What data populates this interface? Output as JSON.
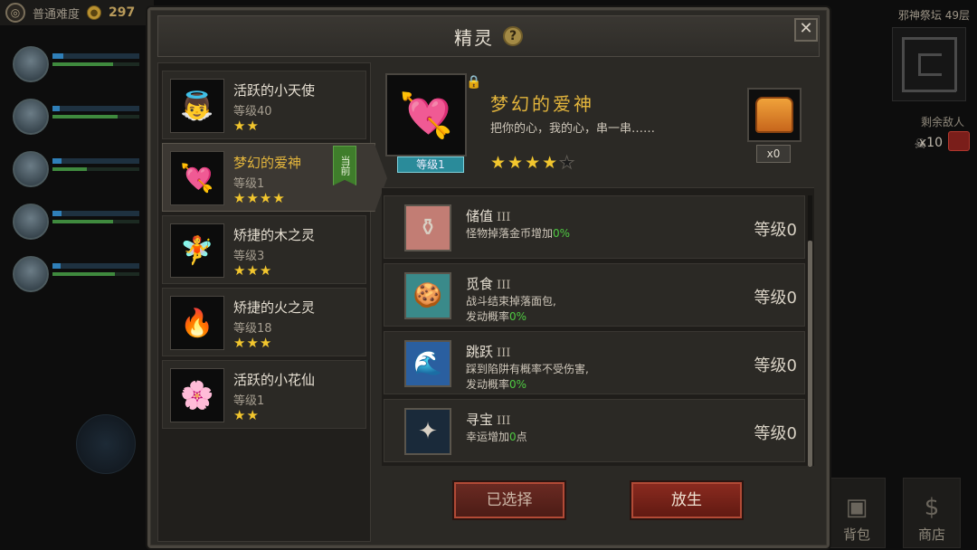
{
  "background": {
    "difficulty_label": "普通难度",
    "coin_value": "297",
    "altar_name": "邪神祭坛 49层",
    "remaining_label": "剩余敌人",
    "enemy_count": "x10",
    "bag_label": "背包",
    "shop_label": "商店",
    "party": [
      {
        "hp": 0.12,
        "mp": 0.7
      },
      {
        "hp": 0.08,
        "mp": 0.75
      },
      {
        "hp": 0.1,
        "mp": 0.4
      },
      {
        "hp": 0.1,
        "mp": 0.7
      },
      {
        "hp": 0.09,
        "mp": 0.72
      }
    ]
  },
  "modal": {
    "title": "精灵",
    "help": "?",
    "close": "✕"
  },
  "spirits": [
    {
      "name": "活跃的小天使",
      "level": "等级40",
      "stars": "★★",
      "icon": "angel",
      "selected": false
    },
    {
      "name": "梦幻的爱神",
      "level": "等级1",
      "stars": "★★★★",
      "icon": "cupid",
      "selected": true,
      "current_tag": "当前"
    },
    {
      "name": "矫捷的木之灵",
      "level": "等级3",
      "stars": "★★★",
      "icon": "wood-spirit",
      "selected": false
    },
    {
      "name": "矫捷的火之灵",
      "level": "等级18",
      "stars": "★★★",
      "icon": "fire-spirit",
      "selected": false
    },
    {
      "name": "活跃的小花仙",
      "level": "等级1",
      "stars": "★★",
      "icon": "flower-fairy",
      "selected": false
    }
  ],
  "detail": {
    "name": "梦幻的爱神",
    "description": "把你的心，我的心，串一串……",
    "level_badge": "等级1",
    "stars_on": "★★★★",
    "stars_off": "★",
    "item_count": "x0"
  },
  "skills": [
    {
      "name": "储值",
      "tier": "III",
      "desc_pre": "怪物掉落金币增加",
      "pct": "0%",
      "desc_post": "",
      "desc_line2_pre": "",
      "desc_line2_pct": "",
      "level": "等级0",
      "icon": "vase-icon",
      "bg": "#c27d74"
    },
    {
      "name": "觅食",
      "tier": "III",
      "desc_pre": "战斗结束掉落面包,",
      "pct": "",
      "desc_post": "",
      "desc_line2_pre": "发动概率",
      "desc_line2_pct": "0%",
      "level": "等级0",
      "icon": "gingerbread-icon",
      "bg": "#3a8a8a"
    },
    {
      "name": "跳跃",
      "tier": "III",
      "desc_pre": "踩到陷阱有概率不受伤害,",
      "pct": "",
      "desc_post": "",
      "desc_line2_pre": "发动概率",
      "desc_line2_pct": "0%",
      "level": "等级0",
      "icon": "jump-icon",
      "bg": "#2a5fa0"
    },
    {
      "name": "寻宝",
      "tier": "III",
      "desc_pre": "幸运增加",
      "pct": "0",
      "desc_post": "点",
      "desc_line2_pre": "",
      "desc_line2_pct": "",
      "level": "等级0",
      "icon": "treasure-icon",
      "bg": "#1a2a3a"
    }
  ],
  "buttons": {
    "selected_label": "已选择",
    "release_label": "放生"
  }
}
